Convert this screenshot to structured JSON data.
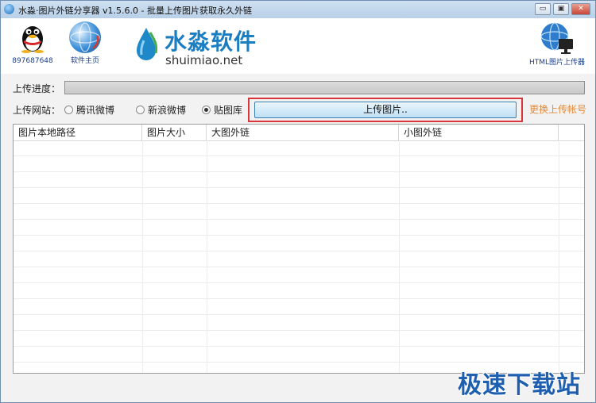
{
  "window": {
    "title": "水淼·图片外链分享器 v1.5.6.0 - 批量上传图片获取永久外链",
    "controls": {
      "minimize": "▭",
      "restore": "▣",
      "close": "✕"
    }
  },
  "header": {
    "qq": {
      "caption": "897687648",
      "icon": "qq-penguin-icon"
    },
    "homepage": {
      "caption": "软件主页",
      "icon": "globe-icon"
    },
    "logo": {
      "cn": "水淼软件",
      "en": "shuimiao.net",
      "icon": "water-drop-icon"
    },
    "uploader": {
      "caption": "HTML图片上传器",
      "icon": "globe-monitor-icon"
    }
  },
  "progress": {
    "label": "上传进度：",
    "value": 0
  },
  "site": {
    "label": "上传网站：",
    "options": [
      {
        "label": "腾讯微博",
        "selected": false
      },
      {
        "label": "新浪微博",
        "selected": false
      },
      {
        "label": "贴图库",
        "selected": true
      }
    ]
  },
  "upload_button": "上传图片..",
  "change_account": "更换上传帐号",
  "table": {
    "columns": [
      "图片本地路径",
      "图片大小",
      "大图外链",
      "小图外链"
    ],
    "rows": []
  },
  "watermark": "极速下载站",
  "colors": {
    "accent": "#1b7ec2",
    "highlight_border": "#d8363a",
    "link_orange": "#e38a3b"
  }
}
